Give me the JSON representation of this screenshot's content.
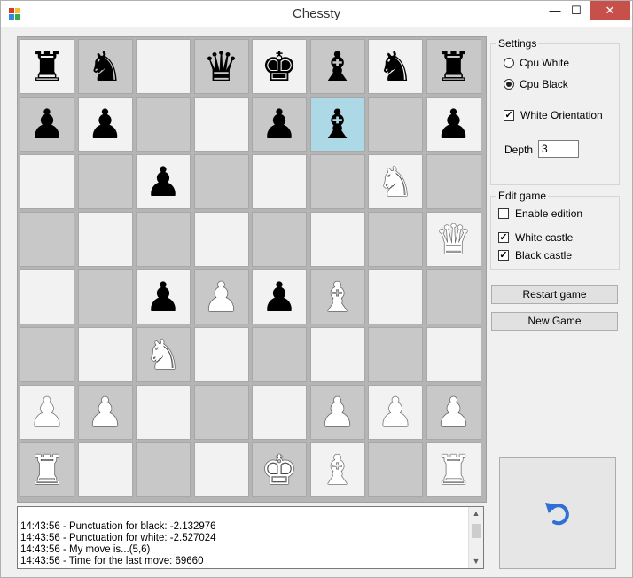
{
  "window": {
    "title": "Chessty",
    "controls": {
      "minimize": "—",
      "maximize": "☐",
      "close": "✕"
    }
  },
  "board": {
    "ranks": [
      [
        "b:♜",
        "b:♞",
        "",
        "b:♛",
        "b:♚",
        "b:♝",
        "b:♞",
        "b:♜"
      ],
      [
        "b:♟",
        "b:♟",
        "",
        "",
        "b:♟",
        "b:♝",
        "",
        "b:♟"
      ],
      [
        "",
        "",
        "b:♟",
        "",
        "",
        "",
        "w:♞",
        ""
      ],
      [
        "",
        "",
        "",
        "",
        "",
        "",
        "",
        "w:♛"
      ],
      [
        "",
        "",
        "b:♟",
        "w:♟",
        "b:♟",
        "w:♝",
        "",
        ""
      ],
      [
        "",
        "",
        "w:♞",
        "",
        "",
        "",
        "",
        ""
      ],
      [
        "w:♟",
        "w:♟",
        "",
        "",
        "",
        "w:♟",
        "w:♟",
        "w:♟"
      ],
      [
        "w:♜",
        "",
        "",
        "",
        "w:♚",
        "w:♝",
        "",
        "w:♜"
      ]
    ],
    "highlighted": {
      "row": 1,
      "col": 5
    },
    "highlight_color": "#add8e6"
  },
  "settings": {
    "title": "Settings",
    "cpu_white": {
      "label": "Cpu White",
      "selected": false
    },
    "cpu_black": {
      "label": "Cpu Black",
      "selected": true
    },
    "white_orientation": {
      "label": "White Orientation",
      "checked": true
    },
    "depth_label": "Depth",
    "depth_value": "3"
  },
  "edit_game": {
    "title": "Edit game",
    "enable_edition": {
      "label": "Enable edition",
      "checked": false
    },
    "white_castle": {
      "label": "White castle",
      "checked": true
    },
    "black_castle": {
      "label": "Black castle",
      "checked": true
    }
  },
  "buttons": {
    "restart": "Restart game",
    "new_game": "New Game",
    "undo_icon": "undo-arrow-icon"
  },
  "log": [
    "14:43:56 - Punctuation for black: -2.132976",
    "14:43:56 - Punctuation for white: -2.527024",
    "14:43:56 - My move is...(5,6)",
    "14:43:56 - Time for the last move: 69660"
  ],
  "colors": {
    "light_square": "#f2f2f2",
    "dark_square": "#c8c8c8",
    "undo_arrow": "#2f6fd6"
  }
}
